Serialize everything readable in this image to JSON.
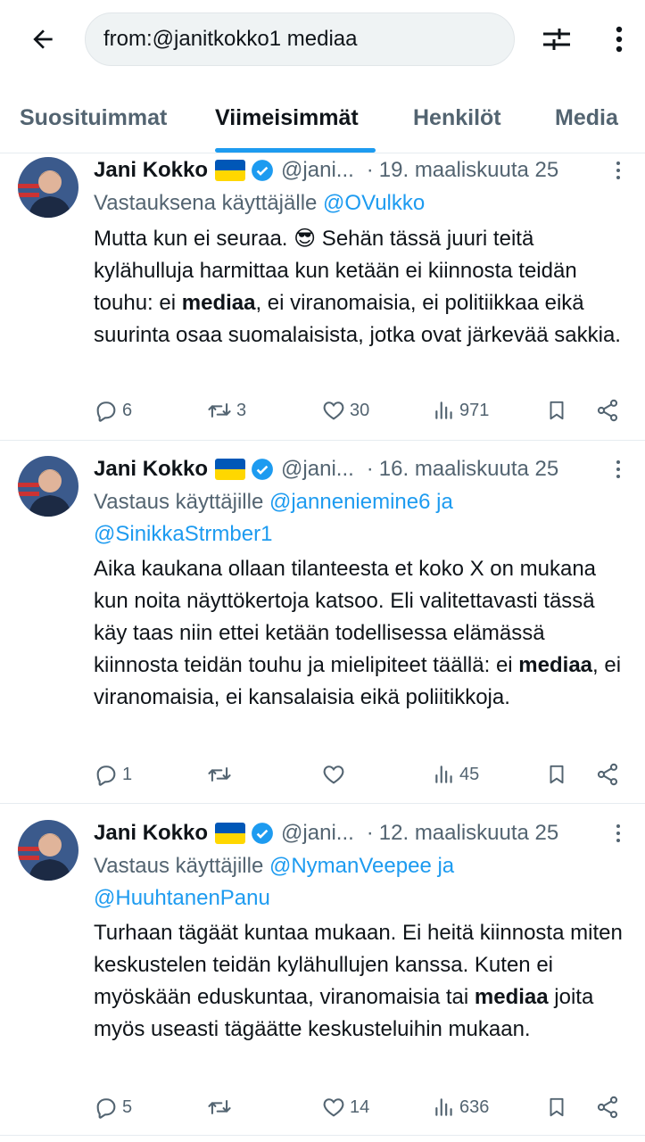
{
  "search": {
    "query": "from:@janitkokko1 mediaa"
  },
  "tabs": [
    {
      "label": "Suosituimmat"
    },
    {
      "label": "Viimeisimmät"
    },
    {
      "label": "Henkilöt"
    },
    {
      "label": "Media"
    }
  ],
  "tweets": [
    {
      "name": "Jani Kokko",
      "handle": "@jani...",
      "dot": "·",
      "date": "19. maaliskuuta 25",
      "reply_prefix": "Vastauksena käyttäjälle ",
      "mentions": [
        "@OVulkko"
      ],
      "mention_joiner": "",
      "text_parts": [
        "Mutta kun ei seuraa. 😎 Sehän tässä juuri teitä kylähulluja harmittaa kun ketään ei kiinnosta teidän touhu: ei ",
        "mediaa",
        ", ei viranomaisia, ei politiikkaa eikä suurinta osaa suomalaisista, jotka ovat järkevää sakkia."
      ],
      "replies": "6",
      "reposts": "3",
      "likes": "30",
      "views": "971"
    },
    {
      "name": "Jani Kokko",
      "handle": "@jani...",
      "dot": "·",
      "date": "16. maaliskuuta 25",
      "reply_prefix": "Vastaus käyttäjille ",
      "mentions": [
        "@janneniemine6",
        "@SinikkaStrmber1"
      ],
      "mention_joiner": " ja",
      "text_parts": [
        "Aika kaukana ollaan tilanteesta et koko X on mukana kun noita näyttökertoja katsoo. Eli valitettavasti tässä käy taas niin ettei ketään todellisessa elämässä kiinnosta teidän touhu ja mielipiteet täällä: ei ",
        "mediaa",
        ", ei viranomaisia, ei kansalaisia eikä poliitikkoja."
      ],
      "replies": "1",
      "reposts": "",
      "likes": "",
      "views": "45"
    },
    {
      "name": "Jani Kokko",
      "handle": "@jani...",
      "dot": "·",
      "date": "12. maaliskuuta 25",
      "reply_prefix": "Vastaus käyttäjille ",
      "mentions": [
        "@NymanVeepee",
        "@HuuhtanenPanu"
      ],
      "mention_joiner": " ja",
      "text_parts": [
        "Turhaan tägäät kuntaa mukaan. Ei heitä kiinnosta miten keskustelen teidän kylähullujen kanssa. Kuten ei myöskään eduskuntaa, viranomaisia tai ",
        "mediaa",
        " joita myös useasti tägäätte keskusteluihin mukaan."
      ],
      "replies": "5",
      "reposts": "",
      "likes": "14",
      "views": "636"
    }
  ],
  "colors": {
    "accent": "#1d9bf0",
    "text": "#0f1419",
    "muted": "#536471",
    "flag_blue": "#0057b7",
    "flag_yellow": "#ffd700"
  },
  "icons": [
    "back-arrow-icon",
    "filter-sliders-icon",
    "more-vertical-icon",
    "verified-badge-icon",
    "reply-icon",
    "repost-icon",
    "like-icon",
    "views-icon",
    "bookmark-icon",
    "share-icon"
  ]
}
